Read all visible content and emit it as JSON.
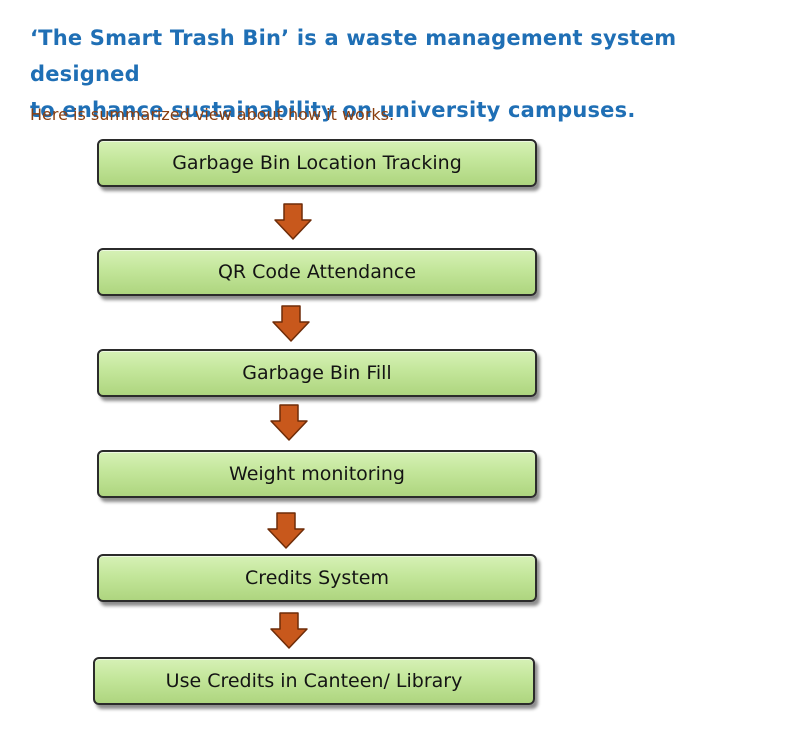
{
  "header": {
    "title_line1": "‘The Smart Trash Bin’ is a waste management system designed",
    "title_line2": "to enhance sustainability on university campuses.",
    "subtitle": "Here is summarized view about how it works."
  },
  "flow": {
    "steps": [
      {
        "label": "Garbage Bin Location Tracking"
      },
      {
        "label": "QR Code Attendance"
      },
      {
        "label": "Garbage Bin Fill"
      },
      {
        "label": "Weight monitoring"
      },
      {
        "label": "Credits System"
      },
      {
        "label": "Use Credits in Canteen/ Library"
      }
    ]
  },
  "colors": {
    "title": "#1f6fb5",
    "subtitle": "#8a3f10",
    "box_fill": "#c3e69a",
    "box_border": "#2b2b2b",
    "arrow_fill": "#c8581c"
  },
  "icons": {
    "arrow": "down-arrow-icon"
  }
}
